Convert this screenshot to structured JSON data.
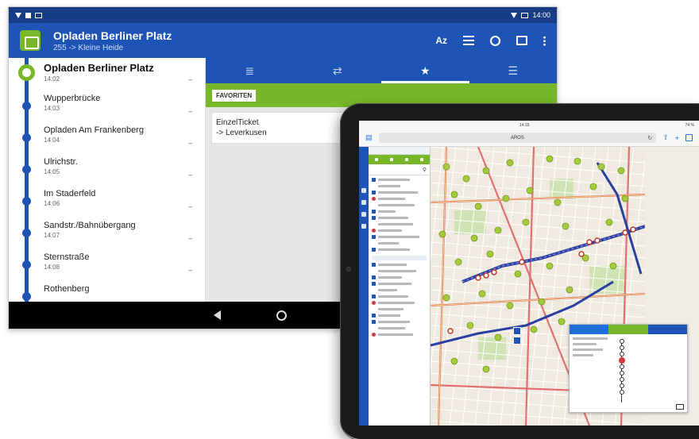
{
  "android": {
    "statusbar": {
      "time": "14:00"
    },
    "appbar": {
      "title": "Opladen Berliner Platz",
      "subtitle": "255 -> Kleine Heide",
      "az_label": "Az"
    },
    "stops": [
      {
        "name": "Opladen Berliner Platz",
        "time": "14:02",
        "dash": "–",
        "current": true
      },
      {
        "name": "Wupperbrücke",
        "time": "14:03",
        "dash": "–"
      },
      {
        "name": "Opladen Am Frankenberg",
        "time": "14:04",
        "dash": "–"
      },
      {
        "name": "Ulrichstr.",
        "time": "14:05",
        "dash": "–"
      },
      {
        "name": "Im Staderfeld",
        "time": "14:06",
        "dash": "–"
      },
      {
        "name": "Sandstr./Bahnübergang",
        "time": "14:07",
        "dash": "–"
      },
      {
        "name": "Sternstraße",
        "time": "14:08",
        "dash": "–"
      },
      {
        "name": "Rothenberg",
        "time": "",
        "dash": ""
      }
    ],
    "tabs": [
      {
        "icon": "list-icon",
        "glyph": "≣"
      },
      {
        "icon": "shuffle-add-icon",
        "glyph": "⇄"
      },
      {
        "icon": "star-icon",
        "glyph": "★",
        "active": true
      },
      {
        "icon": "menu-icon",
        "glyph": "☰"
      }
    ],
    "favorites_label": "FAVORITEN",
    "ticket": {
      "line1": "EinzelTicket",
      "line2": "-> Leverkusen"
    }
  },
  "ipad": {
    "status_time": "14:15",
    "status_battery": "74 %",
    "url": "AROS"
  },
  "colors": {
    "primary_blue": "#1e54b6",
    "status_blue": "#173c86",
    "accent_green": "#78b72a",
    "stop_red": "#d23a3a"
  }
}
